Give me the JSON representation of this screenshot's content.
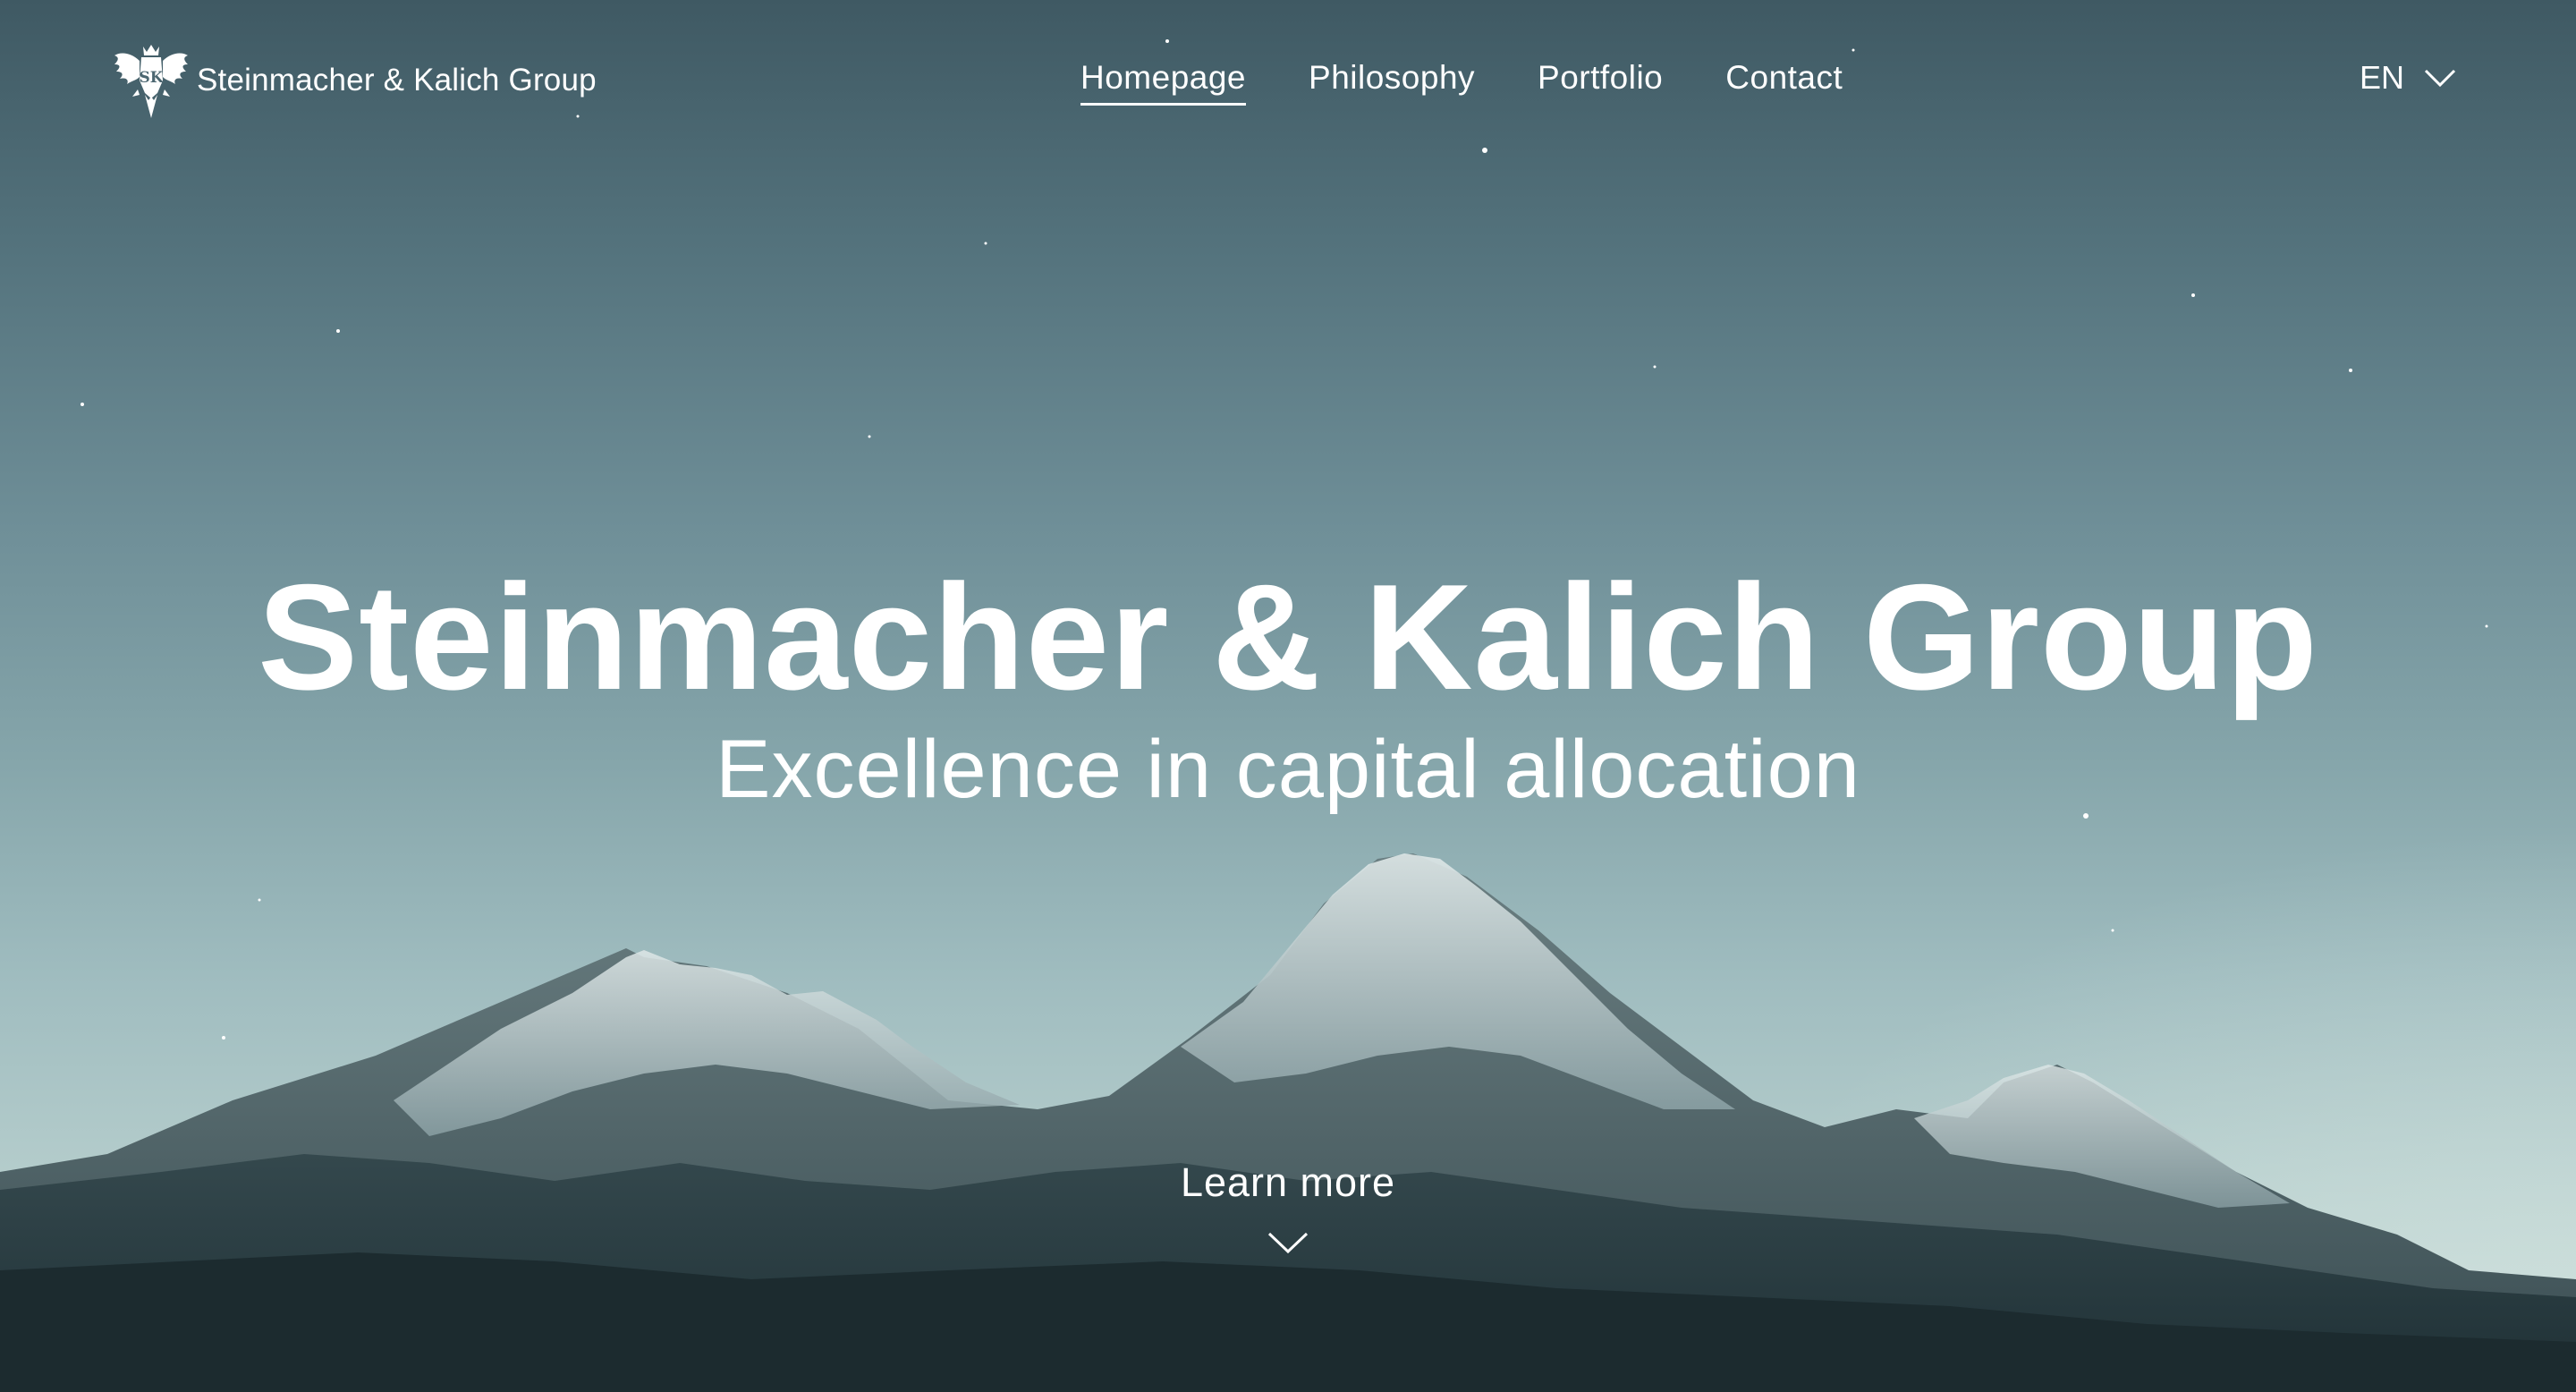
{
  "brand": {
    "name": "Steinmacher & Kalich Group",
    "logo_icon": "eagle-crest-icon",
    "logo_monogram": "SK"
  },
  "nav": {
    "items": [
      {
        "label": "Homepage",
        "active": true
      },
      {
        "label": "Philosophy",
        "active": false
      },
      {
        "label": "Portfolio",
        "active": false
      },
      {
        "label": "Contact",
        "active": false
      }
    ],
    "language": {
      "selected": "EN",
      "icon": "chevron-down-icon"
    }
  },
  "hero": {
    "title": "Steinmacher & Kalich Group",
    "subtitle": "Excellence in capital allocation",
    "cta_label": "Learn more",
    "cta_icon": "chevron-down-icon"
  },
  "colors": {
    "text": "#ffffff",
    "sky_top": "#3f5963",
    "sky_bottom": "#c8dad7",
    "mountain_dark": "#263a40"
  }
}
